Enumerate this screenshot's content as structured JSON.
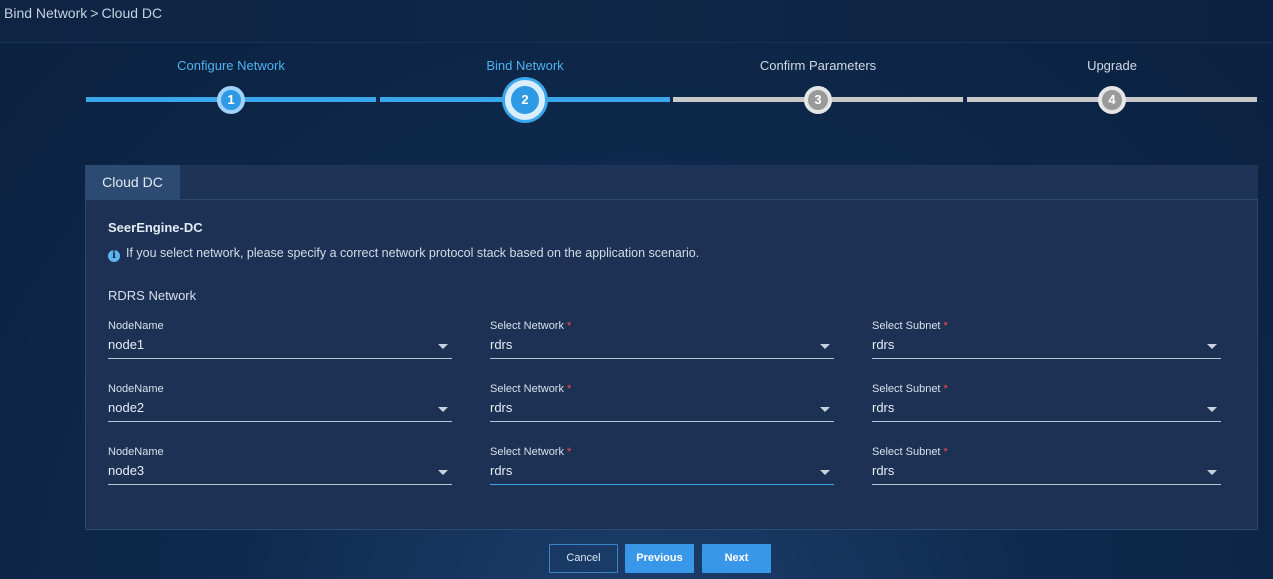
{
  "breadcrumb": {
    "parent": "Bind Network",
    "separator": ">",
    "current": "Cloud DC"
  },
  "stepper": {
    "steps": [
      {
        "number": "1",
        "label": "Configure Network",
        "state": "done"
      },
      {
        "number": "2",
        "label": "Bind Network",
        "state": "active"
      },
      {
        "number": "3",
        "label": "Confirm Parameters",
        "state": "pending"
      },
      {
        "number": "4",
        "label": "Upgrade",
        "state": "pending"
      }
    ]
  },
  "panel": {
    "tab_label": "Cloud DC",
    "heading": "SeerEngine-DC",
    "notice": "If you select network, please specify a correct network protocol stack based on the application scenario.",
    "section_title": "RDRS Network",
    "rows": [
      {
        "node_label": "NodeName",
        "node_value": "node1",
        "network_label": "Select Network",
        "network_value": "rdrs",
        "subnet_label": "Select Subnet",
        "subnet_value": "rdrs"
      },
      {
        "node_label": "NodeName",
        "node_value": "node2",
        "network_label": "Select Network",
        "network_value": "rdrs",
        "subnet_label": "Select Subnet",
        "subnet_value": "rdrs"
      },
      {
        "node_label": "NodeName",
        "node_value": "node3",
        "network_label": "Select Network",
        "network_value": "rdrs",
        "subnet_label": "Select Subnet",
        "subnet_value": "rdrs"
      }
    ],
    "required_mark": "*"
  },
  "footer": {
    "cancel_label": "Cancel",
    "previous_label": "Previous",
    "next_label": "Next"
  },
  "colors": {
    "accent": "#3aa6ec",
    "button": "#3897e8",
    "required": "#ff4d4d",
    "pending": "#c8c8c8"
  }
}
